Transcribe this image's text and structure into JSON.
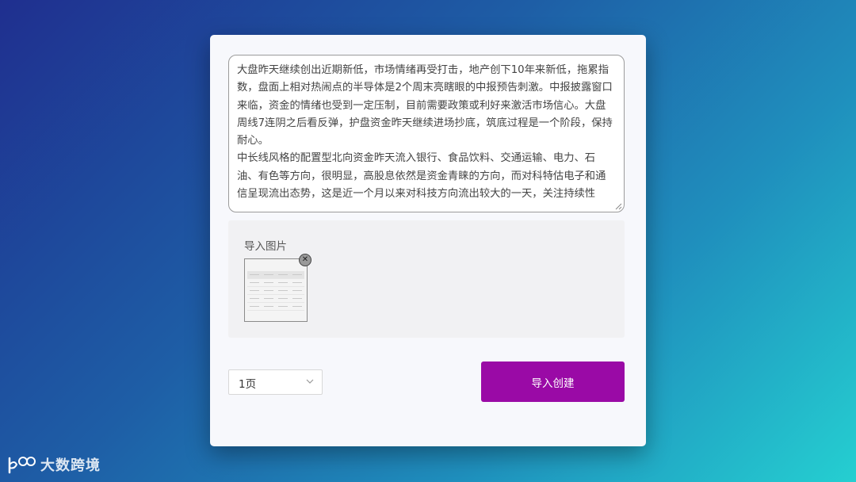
{
  "editor": {
    "text": "大盘昨天继续创出近期新低，市场情绪再受打击，地产创下10年来新低，拖累指数，盘面上相对热闹点的半导体是2个周末亮瞎眼的中报预告刺激。中报披露窗口来临，资金的情绪也受到一定压制，目前需要政策或利好来激活市场信心。大盘周线7连阴之后看反弹，护盘资金昨天继续进场抄底，筑底过程是一个阶段，保持耐心。\n中长线风格的配置型北向资金昨天流入银行、食品饮料、交通运输、电力、石油、有色等方向，很明显，高股息依然是资金青睐的方向，而对科特估电子和通信呈现流出态势，这是近一个月以来对科技方向流出较大的一天，关注持续性"
  },
  "import_section": {
    "label": "导入图片"
  },
  "page_select": {
    "value": "1页"
  },
  "create_button": {
    "label": "导入创建"
  },
  "watermark": {
    "text": "大数跨境"
  },
  "colors": {
    "accent": "#9a0aa6",
    "card_bg": "#f7f8fc",
    "import_bg": "#f1f1f3"
  }
}
